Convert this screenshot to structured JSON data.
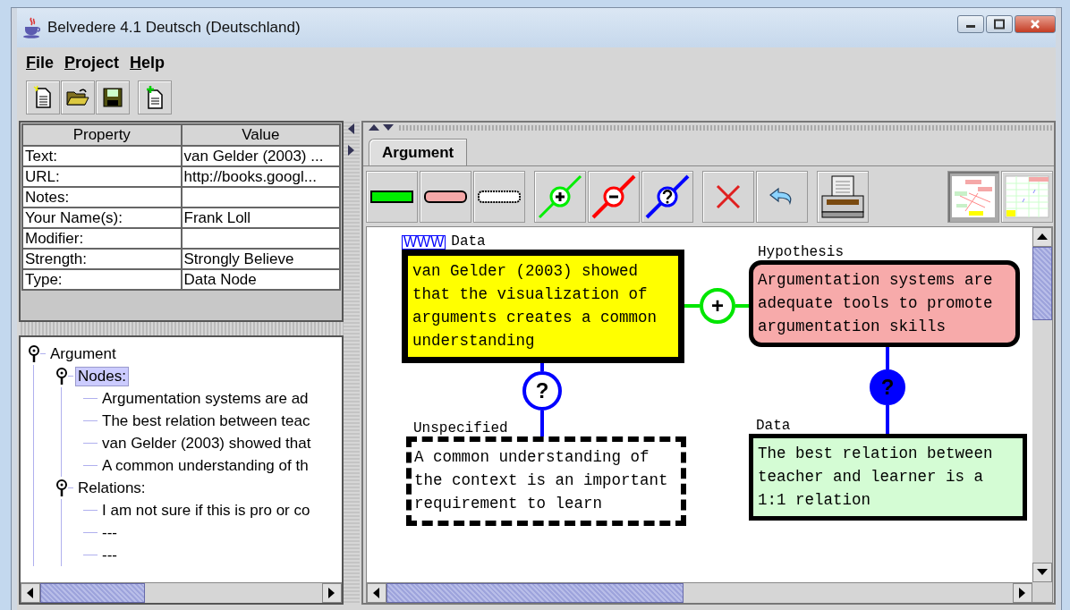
{
  "window": {
    "title": "Belvedere 4.1 Deutsch (Deutschland)"
  },
  "menu": [
    {
      "label": "File"
    },
    {
      "label": "Project"
    },
    {
      "label": "Help"
    }
  ],
  "properties": {
    "columns": [
      "Property",
      "Value"
    ],
    "rows": [
      [
        "Text:",
        "van Gelder (2003) ..."
      ],
      [
        "URL:",
        "http://books.googl..."
      ],
      [
        "Notes:",
        ""
      ],
      [
        "Your Name(s):",
        "Frank Loll"
      ],
      [
        "Modifier:",
        ""
      ],
      [
        "Strength:",
        "Strongly Believe"
      ],
      [
        "Type:",
        "Data Node"
      ]
    ]
  },
  "tree": [
    {
      "label": "Argument",
      "selected": false,
      "children": [
        {
          "label": "Nodes:",
          "selected": true,
          "children": [
            {
              "label": "Argumentation systems are ad",
              "selected": false
            },
            {
              "label": "The best relation between teac",
              "selected": false
            },
            {
              "label": "van Gelder (2003) showed that",
              "selected": false
            },
            {
              "label": "A common understanding of th",
              "selected": false
            }
          ]
        },
        {
          "label": "Relations:",
          "selected": false,
          "children": [
            {
              "label": "I am not sure if this is pro or co",
              "selected": false
            },
            {
              "label": "---",
              "selected": false
            },
            {
              "label": "---",
              "selected": false
            }
          ]
        }
      ]
    }
  ],
  "tabs": [
    {
      "label": "Argument",
      "selected": true
    }
  ],
  "nodes": [
    {
      "kind": "data",
      "type_label": "Data",
      "link_badge": "WWW",
      "text": "van Gelder (2003) showed that the visualization of arguments creates a common understanding",
      "selected": true
    },
    {
      "kind": "hypothesis",
      "type_label": "Hypothesis",
      "text": "Argumentation systems are adequate tools to promote argumentation skills",
      "selected": false
    },
    {
      "kind": "unspecified",
      "type_label": "Unspecified",
      "text": "A common understanding of the context is an important requirement to learn",
      "selected": false
    },
    {
      "kind": "data",
      "type_label": "Data",
      "text": "The best relation between teacher and learner is a 1:1 relation",
      "selected": false
    }
  ],
  "relations": [
    {
      "kind": "pro",
      "symbol": "+",
      "filled": false
    },
    {
      "kind": "unknown",
      "symbol": "?",
      "filled": false
    },
    {
      "kind": "unknown",
      "symbol": "?",
      "filled": true
    }
  ]
}
